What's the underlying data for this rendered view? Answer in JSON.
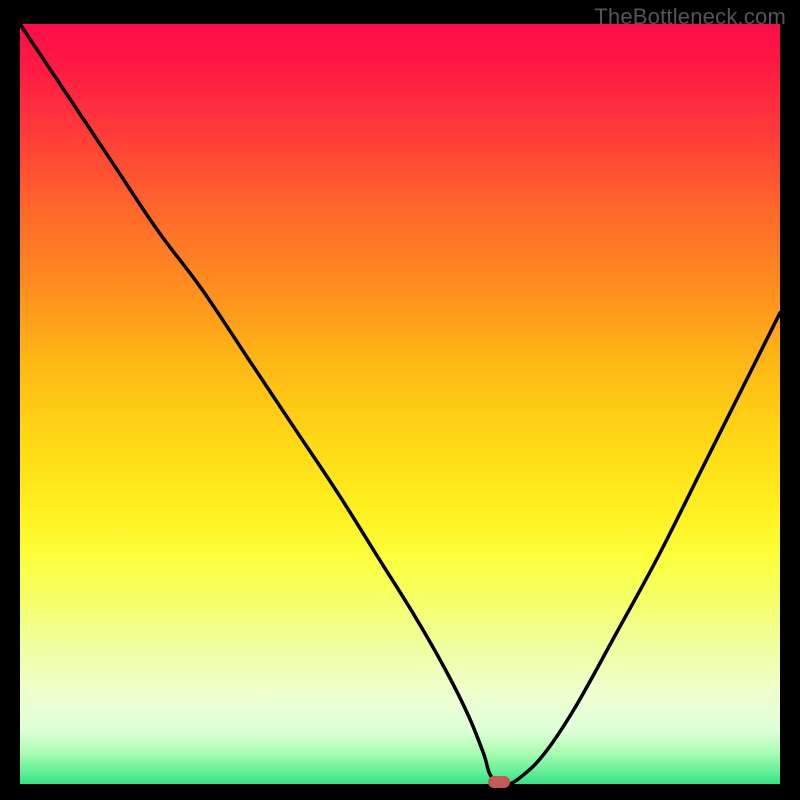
{
  "watermark": "TheBottleneck.com",
  "chart_data": {
    "type": "line",
    "title": "",
    "xlabel": "",
    "ylabel": "",
    "xlim": [
      0,
      100
    ],
    "ylim": [
      0,
      100
    ],
    "x": [
      0,
      6,
      12,
      18,
      24,
      30,
      36,
      42,
      47,
      52,
      56,
      59,
      61,
      62,
      64,
      66,
      69,
      73,
      78,
      84,
      90,
      96,
      100
    ],
    "values": [
      100,
      91,
      82,
      73,
      65,
      56,
      47,
      38,
      30,
      22,
      15,
      9,
      4,
      1,
      0,
      1,
      4,
      10,
      19,
      30,
      42,
      54,
      62
    ],
    "minimum_marker": {
      "x": 63,
      "y": 0
    },
    "background_gradient_stops": [
      {
        "pct": 0,
        "color": "#ff0b48"
      },
      {
        "pct": 14,
        "color": "#ff3a3a"
      },
      {
        "pct": 35,
        "color": "#ff8f1f"
      },
      {
        "pct": 55,
        "color": "#ffd915"
      },
      {
        "pct": 70,
        "color": "#fcff3a"
      },
      {
        "pct": 88,
        "color": "#eeffd0"
      },
      {
        "pct": 100,
        "color": "#35e588"
      }
    ]
  }
}
